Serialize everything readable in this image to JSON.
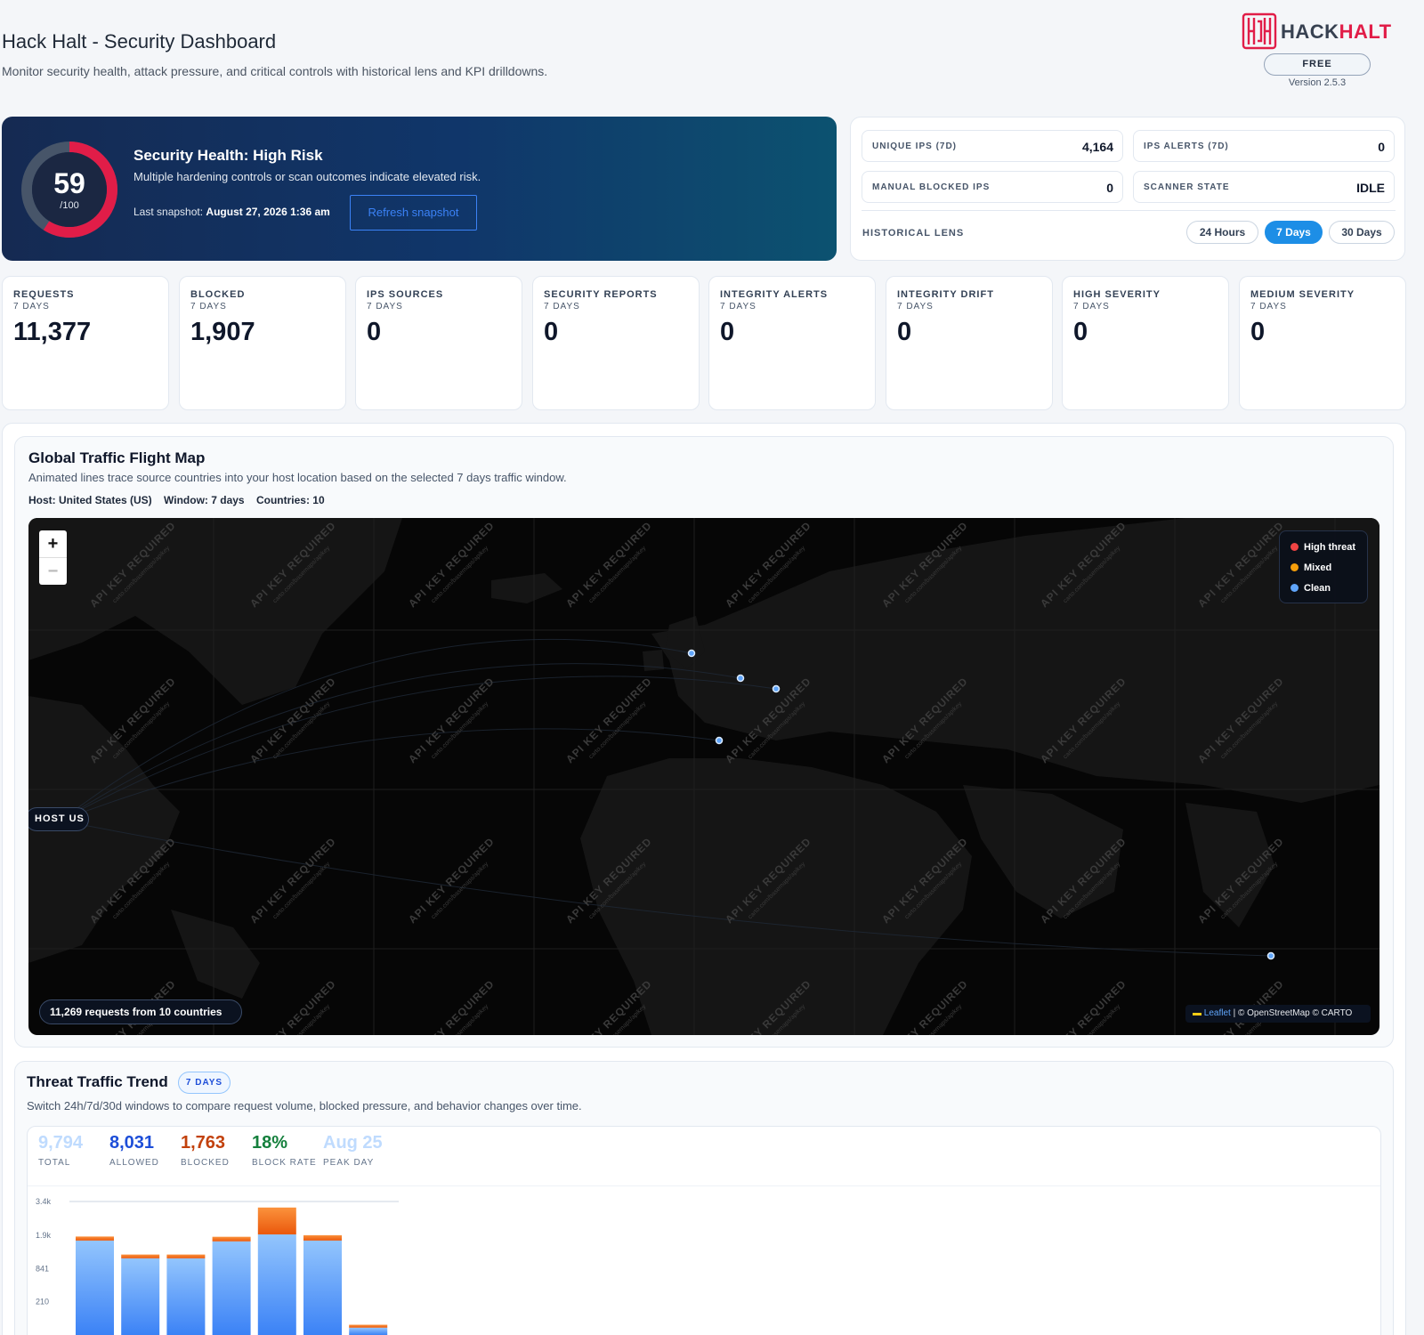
{
  "header": {
    "title": "Hack Halt - Security Dashboard",
    "subtitle": "Monitor security health, attack pressure, and critical controls with historical lens and KPI drilldowns."
  },
  "brand": {
    "name_part1": "HACK",
    "name_part2": "HALT",
    "plan": "FREE",
    "version": "Version 2.5.3",
    "accent_color": "#e11d48"
  },
  "health": {
    "score": "59",
    "score_of": "/100",
    "score_value": 59,
    "title": "Security Health: High Risk",
    "description": "Multiple hardening controls or scan outcomes indicate elevated risk.",
    "snapshot_label": "Last snapshot:",
    "snapshot_time": "August 27, 2026 1:36 am",
    "refresh_label": "Refresh snapshot",
    "ring_color": "#e11d48"
  },
  "stats": {
    "unique_ips": {
      "label": "UNIQUE IPS (7D)",
      "value": "4,164"
    },
    "ips_alerts": {
      "label": "IPS ALERTS (7D)",
      "value": "0"
    },
    "manual_blocked": {
      "label": "MANUAL BLOCKED IPS",
      "value": "0"
    },
    "scanner_state": {
      "label": "SCANNER STATE",
      "value": "IDLE"
    },
    "lens_label": "HISTORICAL LENS",
    "lens_options": [
      "24 Hours",
      "7 Days",
      "30 Days"
    ],
    "lens_selected": "7 Days"
  },
  "kpis": [
    {
      "title": "REQUESTS",
      "sub": "7 DAYS",
      "value": "11,377"
    },
    {
      "title": "BLOCKED",
      "sub": "7 DAYS",
      "value": "1,907"
    },
    {
      "title": "IPS SOURCES",
      "sub": "7 DAYS",
      "value": "0"
    },
    {
      "title": "SECURITY REPORTS",
      "sub": "7 DAYS",
      "value": "0"
    },
    {
      "title": "INTEGRITY ALERTS",
      "sub": "7 DAYS",
      "value": "0"
    },
    {
      "title": "INTEGRITY DRIFT",
      "sub": "7 DAYS",
      "value": "0"
    },
    {
      "title": "HIGH SEVERITY",
      "sub": "7 DAYS",
      "value": "0"
    },
    {
      "title": "MEDIUM SEVERITY",
      "sub": "7 DAYS",
      "value": "0"
    }
  ],
  "map": {
    "title": "Global Traffic Flight Map",
    "description": "Animated lines trace source countries into your host location based on the selected 7 days traffic window.",
    "host": "Host: United States (US)",
    "window": "Window: 7 days",
    "countries": "Countries: 10",
    "zoom_in": "+",
    "zoom_out": "−",
    "legend": [
      {
        "label": "High threat",
        "color": "#ef4444"
      },
      {
        "label": "Mixed",
        "color": "#f59e0b"
      },
      {
        "label": "Clean",
        "color": "#60a5fa"
      }
    ],
    "host_chip": "HOST US",
    "requests_chip": "11,269 requests from 10 countries",
    "attribution_leaflet": "Leaflet",
    "attribution_rest": " | © OpenStreetMap © CARTO",
    "tile_watermark": "API KEY REQUIRED",
    "tile_watermark_sub": "carto.com/basemaps/apikey"
  },
  "trend": {
    "title": "Threat Traffic Trend",
    "badge": "7 DAYS",
    "description": "Switch 24h/7d/30d windows to compare request volume, blocked pressure, and behavior changes over time.",
    "stats": [
      {
        "value": "9,794",
        "label": "TOTAL",
        "color": "#bfdbfe"
      },
      {
        "value": "8,031",
        "label": "ALLOWED",
        "color": "#1d4ed8"
      },
      {
        "value": "1,763",
        "label": "BLOCKED",
        "color": "#c2410c"
      },
      {
        "value": "18%",
        "label": "BLOCK RATE",
        "color": "#15803d"
      },
      {
        "value": "Aug 25",
        "label": "PEAK DAY",
        "color": "#bfdbfe"
      }
    ]
  },
  "chart_data": {
    "type": "bar",
    "y_scale": "sqrt",
    "y_ticks": [
      "3.4k",
      "1.9k",
      "841",
      "210"
    ],
    "y_tick_values": [
      3400,
      1900,
      841,
      210
    ],
    "series": [
      {
        "name": "Allowed",
        "color": "#60a5fa",
        "values": [
          1700,
          1120,
          1120,
          1670,
          1930,
          1700,
          10
        ]
      },
      {
        "name": "Blocked",
        "color": "#f97316",
        "values": [
          150,
          115,
          115,
          170,
          1170,
          200,
          10
        ]
      }
    ]
  }
}
